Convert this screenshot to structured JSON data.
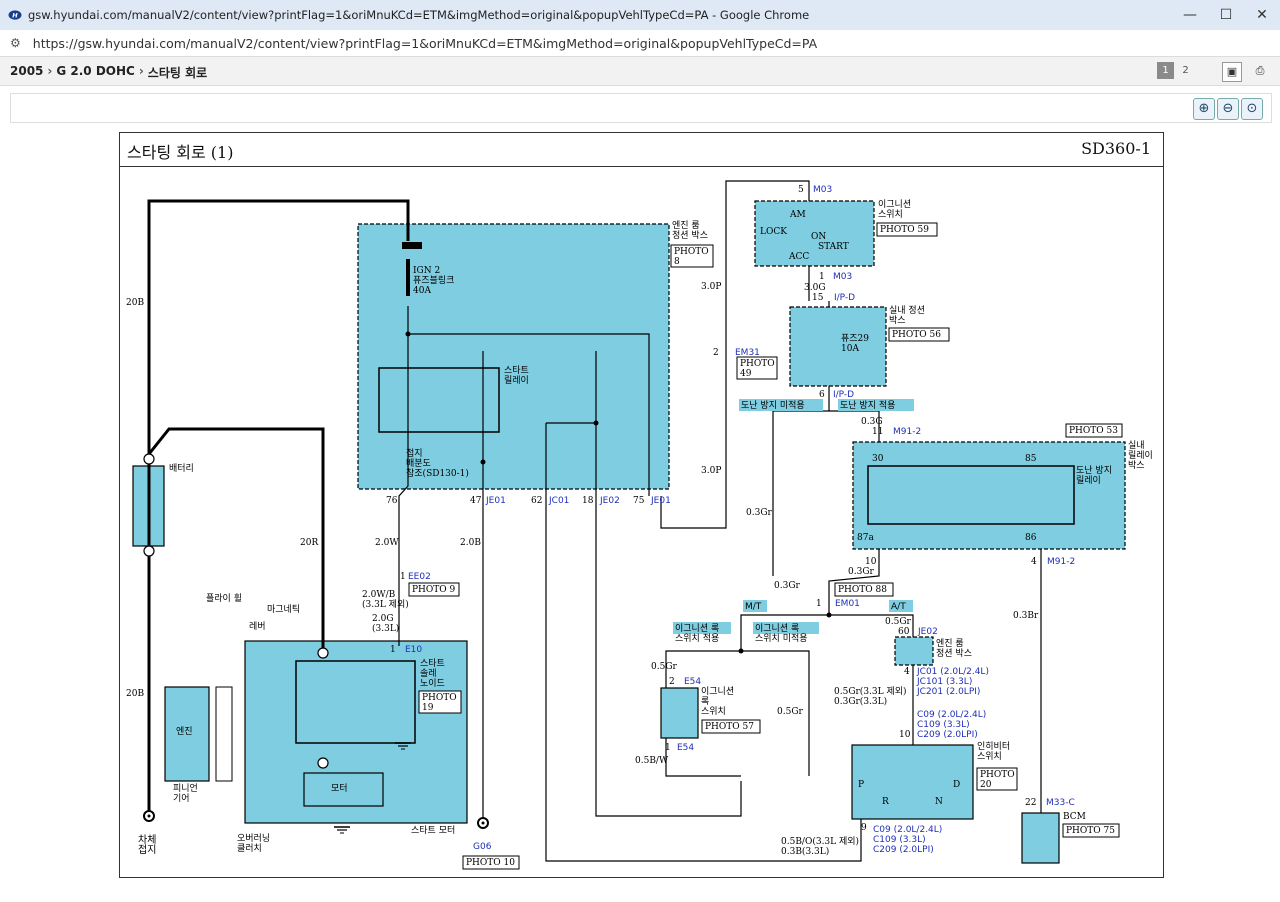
{
  "window": {
    "title": "gsw.hyundai.com/manualV2/content/view?printFlag=1&oriMnuKCd=ETM&imgMethod=original&popupVehlTypeCd=PA - Google Chrome",
    "minimize": "—",
    "maximize": "☐",
    "close": "✕"
  },
  "address": {
    "url": "https://gsw.hyundai.com/manualV2/content/view?printFlag=1&oriMnuKCd=ETM&imgMethod=original&popupVehlTypeCd=PA"
  },
  "breadcrumb": [
    "2005",
    "G 2.0 DOHC",
    "스타팅 회로"
  ],
  "pager": {
    "pages": [
      "1",
      "2"
    ],
    "active": "1"
  },
  "diagram": {
    "title": "스타팅 회로 (1)",
    "code": "SD360-1",
    "colors": {
      "box_fill": "#7fcde0",
      "wire": "#000000",
      "connector_label": "#1f2fb8"
    },
    "labels": {
      "engine_room_box": "엔진 룸\n정션 박스",
      "photo8": "PHOTO\n8",
      "fuse_link": "IGN 2\n퓨즈블링크\n40A",
      "start_relay": "스타트\n릴레이",
      "ground_ref": "접지\n배분도\n참조(SD130-1)",
      "ign_switch": "이그니션\n스위치",
      "photo59": "PHOTO 59",
      "am": "AM",
      "lock": "LOCK",
      "on": "ON",
      "start": "START",
      "acc": "ACC",
      "m03a": "M03",
      "m03b": "M03",
      "pin5": "5",
      "pin1": "1",
      "w30g": "3.0G",
      "pin15": "15",
      "ipd1": "I/P-D",
      "ipd2": "I/P-D",
      "pin6": "6",
      "ij_box": "실내 정션\n박스",
      "photo56": "PHOTO 56",
      "fuse29": "퓨즈29\n10A",
      "w30p1": "3.0P",
      "w30p2": "3.0P",
      "pin2": "2",
      "em31": "EM31",
      "photo49": "PHOTO\n49",
      "anti_not": "도난 방지 미적용",
      "anti_yes": "도난 방지 적용",
      "w03g_a": "0.3G",
      "pin11": "11",
      "m912a": "M91-2",
      "photo53": "PHOTO 53",
      "in_relay_box": "실내\n릴레이\n박스",
      "p30": "30",
      "p85": "85",
      "p87a": "87a",
      "p86": "86",
      "antitheft_relay": "도난 방지\n릴레이",
      "w03gr1": "0.3Gr",
      "p10a": "10",
      "w03gr2": "0.3Gr",
      "photo88": "PHOTO 88",
      "pin1b": "1",
      "em01": "EM01",
      "pin4": "4",
      "m912b": "M91-2",
      "w03br": "0.3Br",
      "battery": "배터리",
      "w20b1": "20B",
      "w20r": "20R",
      "w20b2": "20B",
      "flywheel": "플라이 휠",
      "lever": "레버",
      "magnetic": "마그네틱",
      "engine": "엔진",
      "pinion": "피니언\n기어",
      "overrun": "오버러닝\n클러치",
      "motor": "모터",
      "start_motor": "스타트 모터",
      "start_solenoid": "스타트\n솔레\n노이드",
      "photo19": "PHOTO\n19",
      "body_ground": "차체\n접지",
      "g06": "G06",
      "photo10": "PHOTO 10",
      "p76": "76",
      "p47": "47",
      "je01a": "JE01",
      "p62": "62",
      "jc01": "JC01",
      "p18": "18",
      "je02a": "JE02",
      "p75": "75",
      "je01b": "JE01",
      "w20w": "2.0W",
      "w20b3": "2.0B",
      "pin1c": "1",
      "ee02": "EE02",
      "photo9": "PHOTO 9",
      "w20wb": "2.0W/B\n(3.3L 제외)",
      "w20g": "2.0G\n(3.3L)",
      "pin1d": "1",
      "e10": "E10",
      "mt": "M/T",
      "at": "A/T",
      "ign_lock_yes": "이그니션 록\n스위치 적용",
      "ign_lock_no": "이그니션 록\n스위치 미적용",
      "w05gr1": "0.5Gr",
      "pin2b": "2",
      "e54a": "E54",
      "ign_lock_sw": "이그니션\n록\n스위치",
      "photo57": "PHOTO 57",
      "pin1e": "1",
      "e54b": "E54",
      "w05bw": "0.5B/W",
      "w05gr2": "0.5Gr",
      "w05gr3": "0.5Gr",
      "p60": "60",
      "je02b": "JE02",
      "engine_box2": "엔진 룸\n정션 박스",
      "p4b": "4",
      "jc01b": "JC01 (2.0L/2.4L)\nJC101 (3.3L)\nJC201 (2.0LPI)",
      "w05gr33": "0.5Gr(3.3L 제외)\n0.3Gr(3.3L)",
      "p10b": "10",
      "c09a": "C09 (2.0L/2.4L)\nC109 (3.3L)\nC209 (2.0LPI)",
      "inhibitor": "인히비터\n스위치",
      "photo20": "PHOTO\n20",
      "P": "P",
      "R": "R",
      "N": "N",
      "D": "D",
      "p9": "9",
      "c09b": "C09 (2.0L/2.4L)\nC109 (3.3L)\nC209 (2.0LPI)",
      "w05bo": "0.5B/O(3.3L 제외)\n0.3B(3.3L)",
      "p22": "22",
      "m33c": "M33-C",
      "bcm": "BCM",
      "photo75": "PHOTO 75",
      "w03gr3": "0.3Gr"
    }
  }
}
